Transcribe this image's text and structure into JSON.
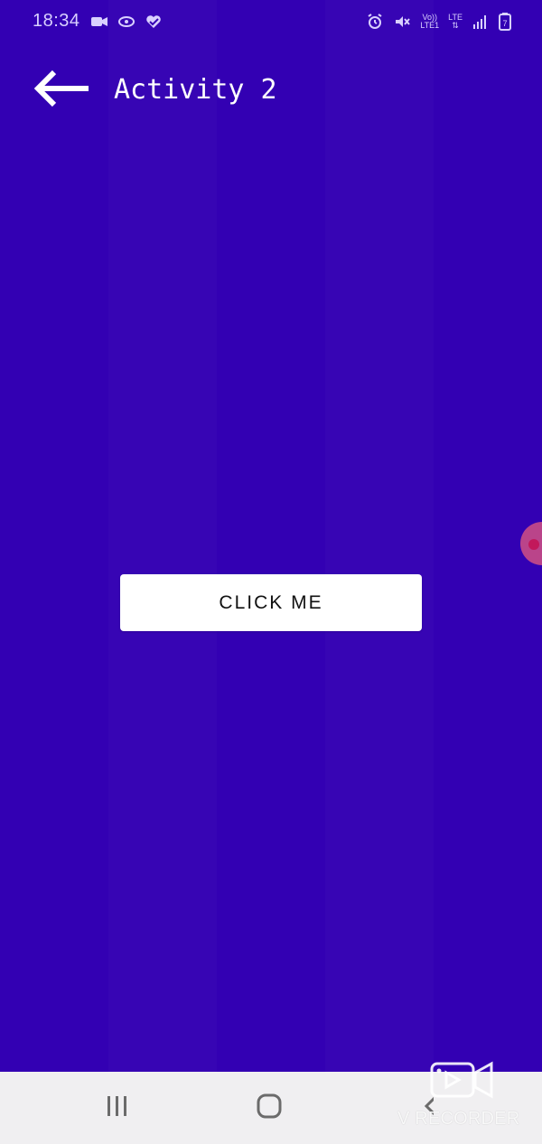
{
  "status_bar": {
    "time": "18:34",
    "network": {
      "top": "Vo))",
      "mid": "LTE",
      "bottom": "LTE1",
      "lte": "LTE"
    },
    "battery_level": "7"
  },
  "app_bar": {
    "title": "Activity 2",
    "back_icon": "arrow-left-icon"
  },
  "main": {
    "button_label": "CLICK ME"
  },
  "nav_bar": {
    "recent_icon": "recent-apps-icon",
    "home_icon": "home-icon",
    "back_icon": "back-chevron-icon"
  },
  "watermark": {
    "text": "V RECORDER"
  },
  "colors": {
    "background": "#3300b3",
    "button_bg": "#ffffff",
    "nav_bg": "#f0eff1",
    "touch_indicator": "#d25082"
  }
}
